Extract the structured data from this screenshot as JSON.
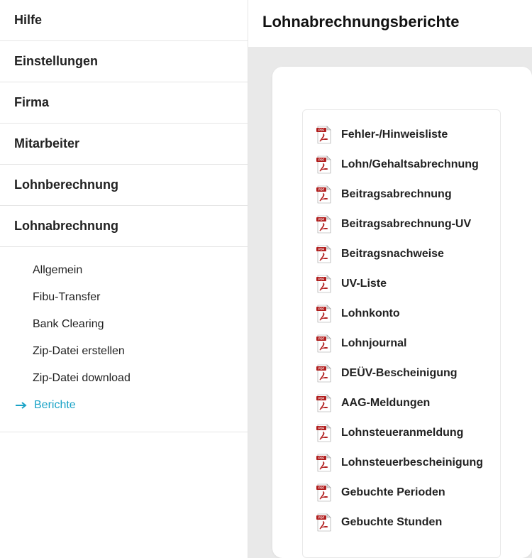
{
  "sidebar": {
    "items": [
      {
        "label": "Hilfe",
        "name": "nav-hilfe"
      },
      {
        "label": "Einstellungen",
        "name": "nav-einstellungen"
      },
      {
        "label": "Firma",
        "name": "nav-firma"
      },
      {
        "label": "Mitarbeiter",
        "name": "nav-mitarbeiter"
      },
      {
        "label": "Lohnberechnung",
        "name": "nav-lohnberechnung"
      },
      {
        "label": "Lohnabrechnung",
        "name": "nav-lohnabrechnung"
      }
    ],
    "subitems": [
      {
        "label": "Allgemein",
        "name": "subnav-allgemein",
        "active": false
      },
      {
        "label": "Fibu-Transfer",
        "name": "subnav-fibu-transfer",
        "active": false
      },
      {
        "label": "Bank Clearing",
        "name": "subnav-bank-clearing",
        "active": false
      },
      {
        "label": "Zip-Datei erstellen",
        "name": "subnav-zip-erstellen",
        "active": false
      },
      {
        "label": "Zip-Datei download",
        "name": "subnav-zip-download",
        "active": false
      },
      {
        "label": "Berichte",
        "name": "subnav-berichte",
        "active": true
      }
    ]
  },
  "page": {
    "title": "Lohnabrechnungsberichte"
  },
  "reports": [
    {
      "label": "Fehler-/Hinweisliste",
      "name": "report-fehler-hinweisliste"
    },
    {
      "label": "Lohn/Gehaltsabrechnung",
      "name": "report-lohn-gehaltsabrechnung"
    },
    {
      "label": "Beitragsabrechnung",
      "name": "report-beitragsabrechnung"
    },
    {
      "label": "Beitragsabrechnung-UV",
      "name": "report-beitragsabrechnung-uv"
    },
    {
      "label": "Beitragsnachweise",
      "name": "report-beitragsnachweise"
    },
    {
      "label": "UV-Liste",
      "name": "report-uv-liste"
    },
    {
      "label": "Lohnkonto",
      "name": "report-lohnkonto"
    },
    {
      "label": "Lohnjournal",
      "name": "report-lohnjournal"
    },
    {
      "label": "DEÜV-Bescheinigung",
      "name": "report-deuev-bescheinigung"
    },
    {
      "label": "AAG-Meldungen",
      "name": "report-aag-meldungen"
    },
    {
      "label": "Lohnsteueranmeldung",
      "name": "report-lohnsteueranmeldung"
    },
    {
      "label": "Lohnsteuerbescheinigung",
      "name": "report-lohnsteuerbescheinigung"
    },
    {
      "label": "Gebuchte Perioden",
      "name": "report-gebuchte-perioden"
    },
    {
      "label": "Gebuchte Stunden",
      "name": "report-gebuchte-stunden"
    }
  ]
}
